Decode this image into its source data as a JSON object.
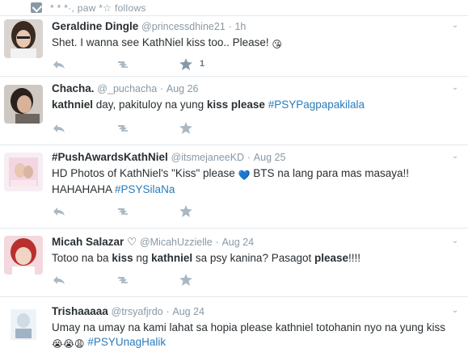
{
  "topbar": {
    "follows_text": "* * *·, paw  *☆ follows",
    "icon": "follow-icon"
  },
  "tweets": [
    {
      "name": "Geraldine Dingle",
      "handle": "@princessdhine21",
      "dot": "·",
      "time": "1h",
      "text_plain": "Shet. I wanna see KathNiel kiss too.. Please! ",
      "emoji": "😘",
      "favorite_count": "1",
      "avatar": "avatar-geraldine"
    },
    {
      "name": "Chacha.",
      "handle": "@_puchacha",
      "dot": "·",
      "time": "Aug 26",
      "text_parts": [
        "kathniel",
        " day, pakituloy na yung ",
        "kiss please",
        " "
      ],
      "hashtag": "#PSYPagpapakilala",
      "avatar": "avatar-chacha"
    },
    {
      "name": "#PushAwardsKathNiel",
      "handle": "@itsmejaneeKD",
      "dot": "·",
      "time": "Aug 25",
      "text_a": "HD Photos of KathNiel's \"Kiss\" please ",
      "emoji": "💙",
      "text_b": " BTS na lang para mas masaya!! HAHAHAHA ",
      "hashtag": "#PSYSilaNa",
      "avatar": "avatar-pushawards"
    },
    {
      "name": "Micah Salazar",
      "heart": "♡",
      "handle": "@MicahUzzielle",
      "dot": "·",
      "time": "Aug 24",
      "text_parts": [
        "Totoo na ba ",
        "kiss",
        " ng ",
        "kathniel",
        " sa psy kanina? Pasagot ",
        "please",
        "!!!!"
      ],
      "avatar": "avatar-micah"
    },
    {
      "name": "Trishaaaaa",
      "handle": "@trsyafjrdo",
      "dot": "·",
      "time": "Aug 24",
      "text_a": "Umay na umay na kami lahat sa hopia please kathniel totohanin nyo na yung kiss ",
      "emoji": "😭😭😩",
      "hashtag": " #PSYUnagHalik",
      "avatar": "avatar-trisha"
    }
  ],
  "colors": {
    "link": "#2b7bb9",
    "meta": "#8899a6",
    "icon": "#aab8c2",
    "border": "#e1e8ed"
  }
}
